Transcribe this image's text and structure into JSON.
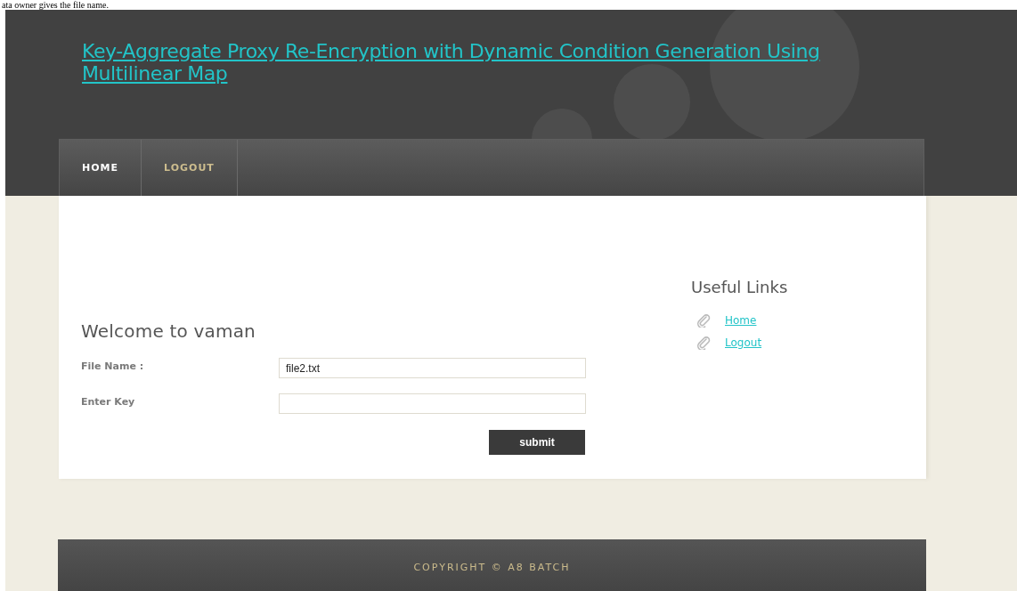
{
  "document_text": "ata owner gives the file name.",
  "site_title": "Key-Aggregate Proxy Re-Encryption with Dynamic Condition Generation Using Multilinear Map",
  "nav": [
    {
      "label": "HOME",
      "selected": true
    },
    {
      "label": "LOGOUT",
      "selected": false
    }
  ],
  "main": {
    "heading": "Welcome to vaman",
    "fields": [
      {
        "label": "File Name :",
        "value": "file2.txt"
      },
      {
        "label": "Enter Key"
      }
    ],
    "button": "submit"
  },
  "sidebar": {
    "heading": "Useful Links",
    "links": [
      "Home",
      "Logout"
    ]
  },
  "footer": "COPYRIGHT © A8 BATCH"
}
